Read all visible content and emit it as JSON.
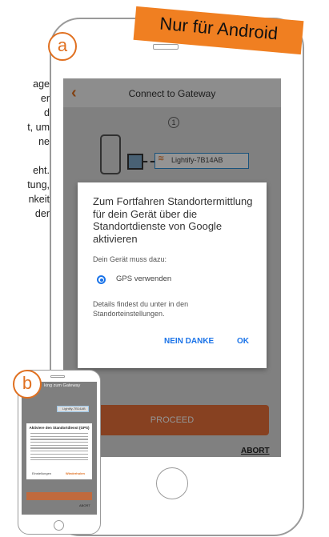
{
  "side_text": {
    "lines": [
      "age",
      "er",
      "d",
      "t, um",
      "ne",
      "",
      "eht.",
      "tung,",
      "nkeit",
      "der"
    ]
  },
  "banner": {
    "text": "Nur für Android"
  },
  "badges": {
    "a": "a",
    "b": "b"
  },
  "phone_a": {
    "app_title": "Connect to Gateway",
    "back_icon": "chevron-left-icon",
    "step_number": "1",
    "ssid": "Lightify-7B14AB",
    "proceed_label": "PROCEED",
    "abort_label": "ABORT",
    "dialog": {
      "title": "Zum Fortfahren Standortermitt­lung für dein Gerät über die Standortdienste von Google aktivieren",
      "subtitle": "Dein Gerät muss dazu:",
      "gps_label": "GPS verwenden",
      "details": "Details findest du unter in den Standorteinstellungen.",
      "negative_button": "NEIN DANKE",
      "positive_button": "OK"
    }
  },
  "phone_b": {
    "app_title": "king zum Gateway",
    "ssid": "Lightify-7B14AB",
    "dialog_title": "Aktiviere den Standortdienst (GPS)",
    "button_left": "Einstellungen",
    "button_right": "Wiederholen",
    "abort_label": "ABORT"
  },
  "colors": {
    "accent": "#e07020",
    "banner": "#f07f21",
    "link_blue": "#1a73e8",
    "proceed": "#e8703a"
  }
}
